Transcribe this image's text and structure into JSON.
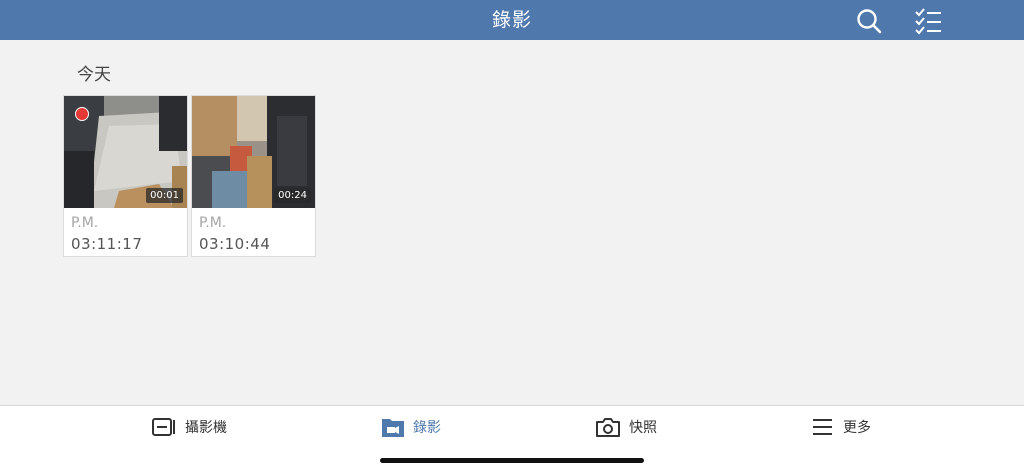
{
  "header": {
    "title": "錄影",
    "search_icon": "search-icon",
    "select_icon": "checklist-icon",
    "color": "#4f78ad"
  },
  "section": {
    "title": "今天"
  },
  "recordings": [
    {
      "ampm": "P.M.",
      "time": "03:11:17",
      "duration": "00:01",
      "recording_indicator": true
    },
    {
      "ampm": "P.M.",
      "time": "03:10:44",
      "duration": "00:24",
      "recording_indicator": false
    }
  ],
  "tabs": [
    {
      "label": "攝影機",
      "icon": "camera-device-icon",
      "active": false
    },
    {
      "label": "錄影",
      "icon": "video-folder-icon",
      "active": true
    },
    {
      "label": "快照",
      "icon": "camera-icon",
      "active": false
    },
    {
      "label": "更多",
      "icon": "menu-icon",
      "active": false
    }
  ]
}
